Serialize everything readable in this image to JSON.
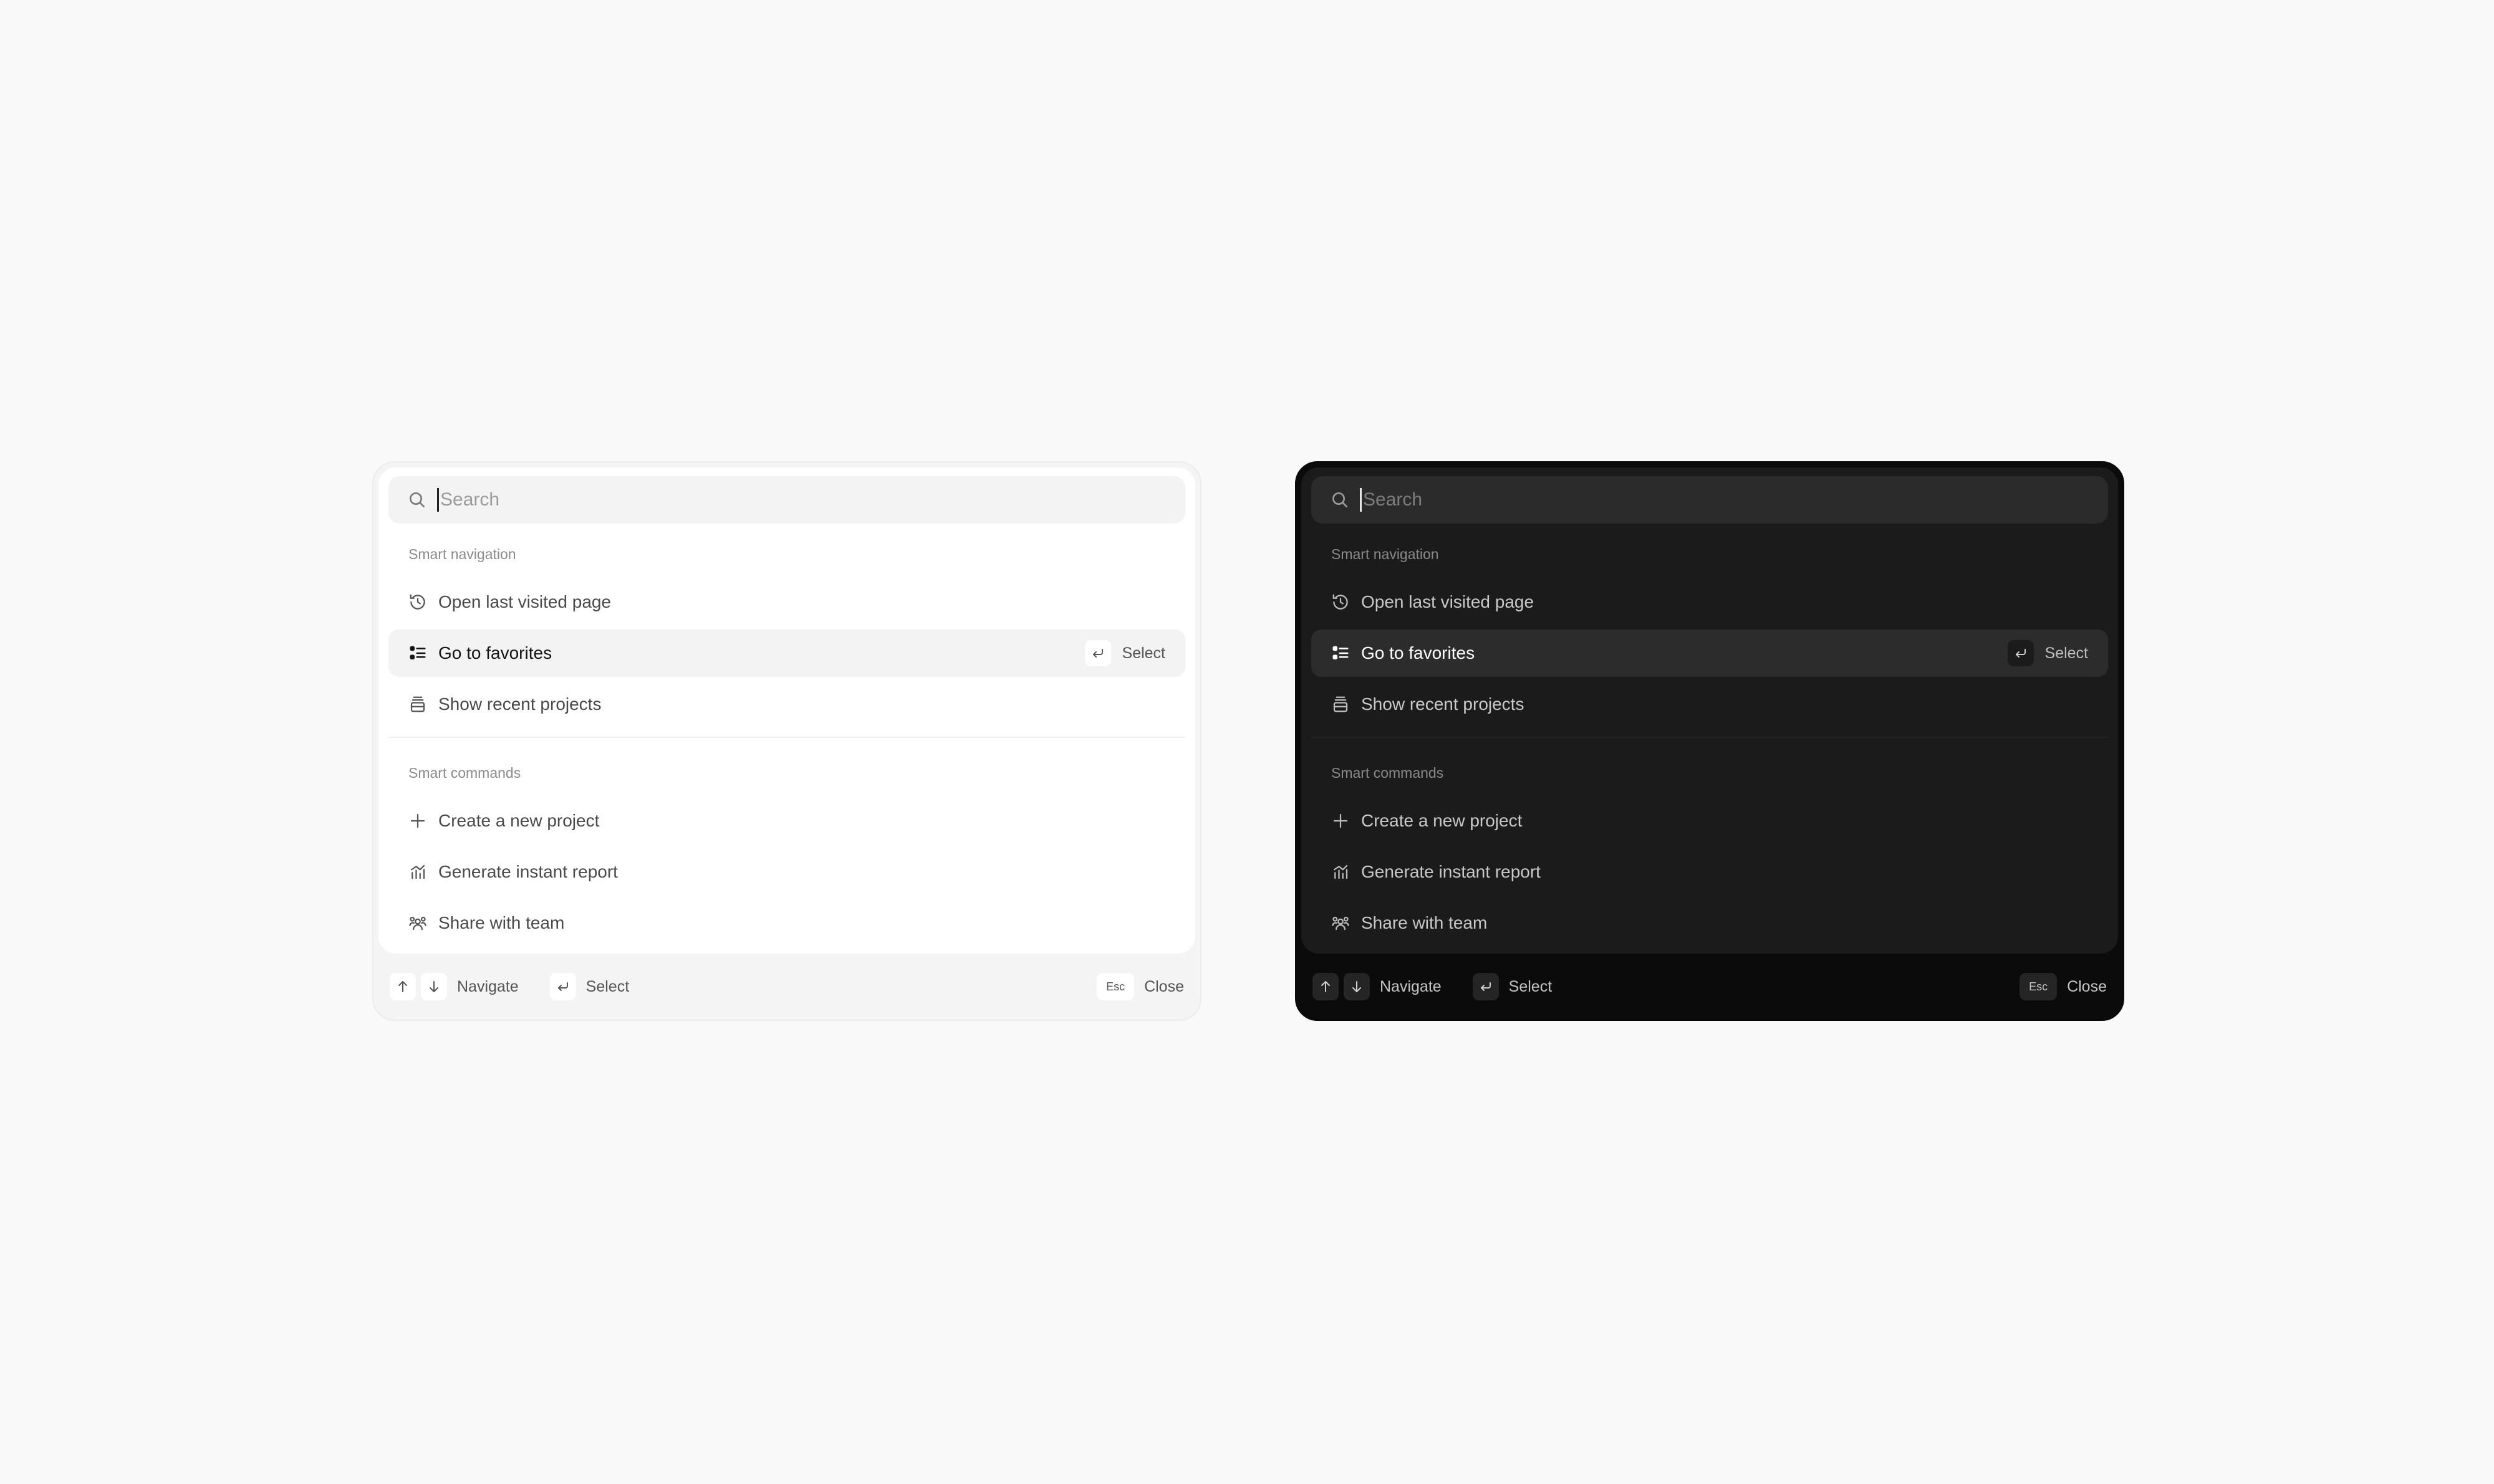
{
  "search": {
    "placeholder": "Search",
    "value": ""
  },
  "groups": {
    "navigation": {
      "label": "Smart navigation",
      "items": [
        {
          "label": "Open last visited page",
          "icon": "history-icon"
        },
        {
          "label": "Go to favorites",
          "icon": "list-icon",
          "active": true
        },
        {
          "label": "Show recent projects",
          "icon": "archive-icon"
        }
      ]
    },
    "commands": {
      "label": "Smart commands",
      "items": [
        {
          "label": "Create a new project",
          "icon": "plus-icon"
        },
        {
          "label": "Generate instant report",
          "icon": "chart-icon"
        },
        {
          "label": "Share with team",
          "icon": "users-icon"
        }
      ]
    }
  },
  "active_hint": {
    "label": "Select",
    "key_icon": "enter-icon"
  },
  "footer": {
    "navigate_label": "Navigate",
    "select_label": "Select",
    "esc_key": "Esc",
    "close_label": "Close"
  },
  "themes": {
    "light": {
      "background": "#ffffff",
      "frame": "#f4f4f4"
    },
    "dark": {
      "background": "#1b1b1b",
      "frame": "#0b0b0b"
    }
  }
}
